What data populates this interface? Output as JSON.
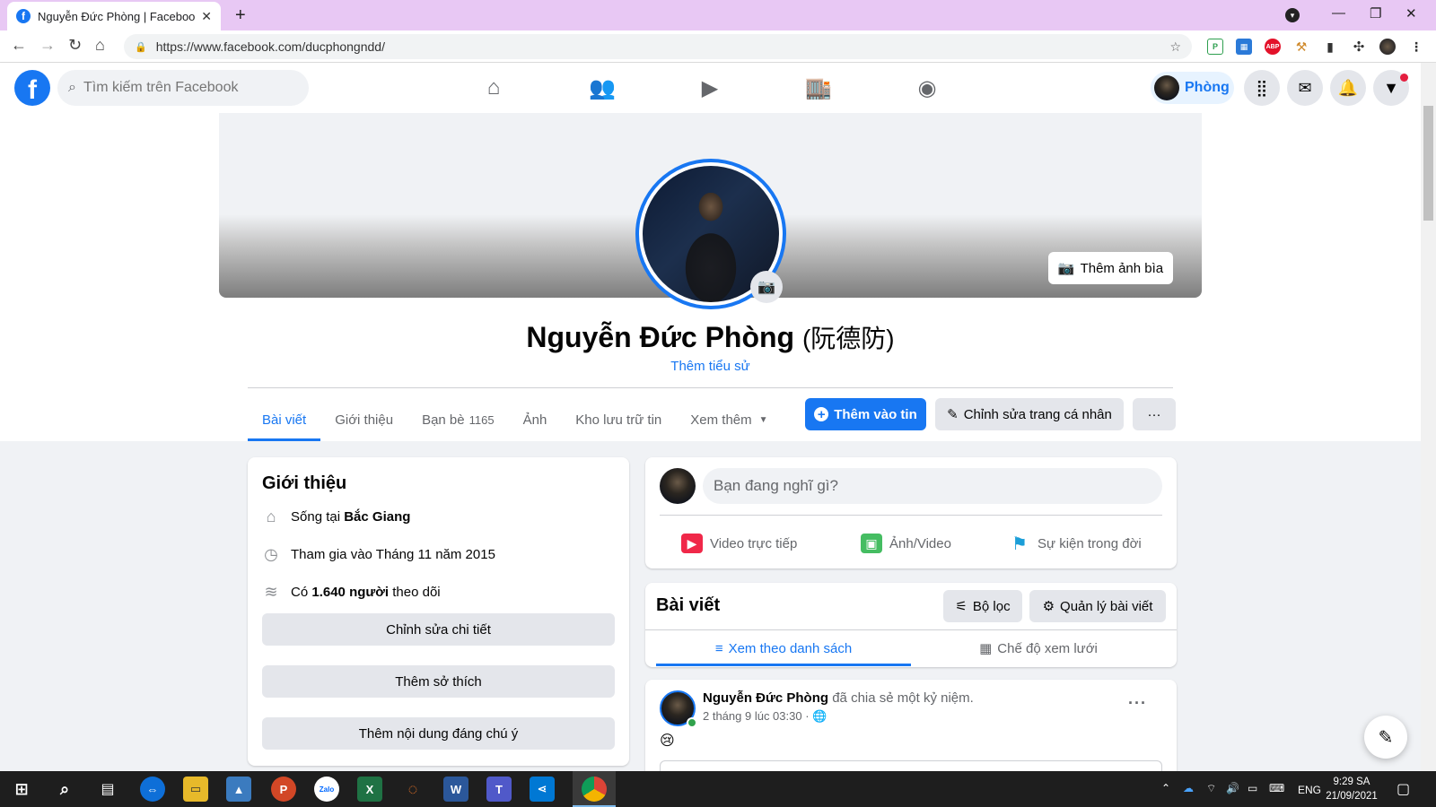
{
  "browser": {
    "tab_title": "Nguyễn Đức Phòng | Facebook",
    "tab_close": "✕",
    "new_tab": "+",
    "url": "https://www.facebook.com/ducphongndd/",
    "extensions": [
      "P",
      "ABP"
    ]
  },
  "fb_nav": {
    "logo": "f",
    "search_placeholder": "Tìm kiếm trên Facebook",
    "profile_name": "Phòng"
  },
  "profile": {
    "add_cover_label": "Thêm ảnh bìa",
    "name": "Nguyễn Đức Phòng",
    "alt_name": "(阮德防)",
    "add_bio": "Thêm tiểu sử",
    "tabs": [
      {
        "label": "Bài viết",
        "count": ""
      },
      {
        "label": "Giới thiệu",
        "count": ""
      },
      {
        "label": "Bạn bè",
        "count": "1165"
      },
      {
        "label": "Ảnh",
        "count": ""
      },
      {
        "label": "Kho lưu trữ tin",
        "count": ""
      },
      {
        "label": "Xem thêm",
        "count": ""
      }
    ],
    "add_story": "Thêm vào tin",
    "edit_profile": "Chỉnh sửa trang cá nhân",
    "more": "···"
  },
  "intro": {
    "title": "Giới thiệu",
    "lives_prefix": "Sống tại ",
    "lives_place": "Bắc Giang",
    "joined": "Tham gia vào Tháng 11 năm 2015",
    "followers_prefix": "Có ",
    "followers_count": "1.640 người",
    "followers_suffix": " theo dõi",
    "btn_edit_details": "Chỉnh sửa chi tiết",
    "btn_add_hobbies": "Thêm sở thích",
    "btn_add_featured": "Thêm nội dung đáng chú ý"
  },
  "composer": {
    "placeholder": "Bạn đang nghĩ gì?",
    "live_video": "Video trực tiếp",
    "photo_video": "Ảnh/Video",
    "life_event": "Sự kiện trong đời"
  },
  "posts": {
    "title": "Bài viết",
    "filter": "Bộ lọc",
    "manage": "Quản lý bài viết",
    "list_view": "Xem theo danh sách",
    "grid_view": "Chế độ xem lưới"
  },
  "post": {
    "author": "Nguyễn Đức Phòng",
    "action": "đã chia sẻ một kỷ niệm.",
    "time": "2 tháng 9 lúc 03:30 ·",
    "emoji": "😢"
  },
  "taskbar": {
    "lang": "ENG",
    "time": "9:29 SA",
    "date": "21/09/2021"
  },
  "colors": {
    "brand_blue": "#1877f2",
    "page_bg": "#f0f2f5",
    "tab_strip": "#e8c8f4",
    "online_green": "#31a24c"
  }
}
